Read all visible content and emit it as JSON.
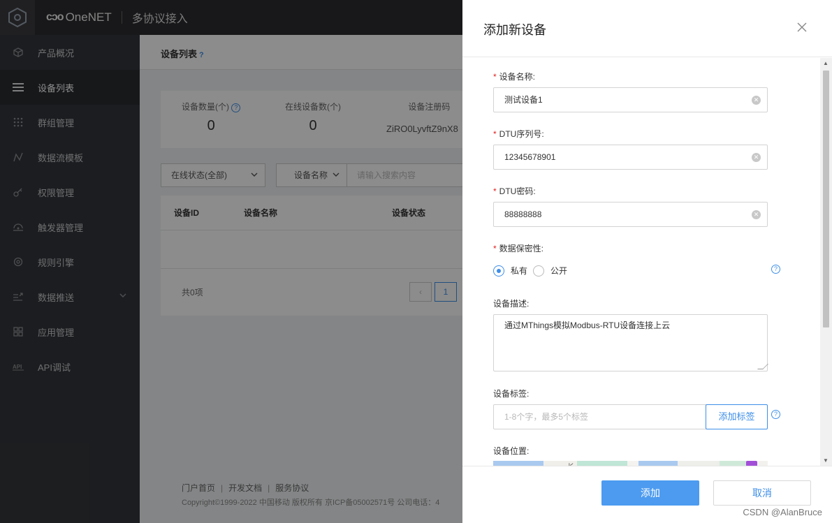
{
  "topbar": {
    "brand": "OneNET",
    "brand_logo_text": "cɔo",
    "subtitle": "多协议接入"
  },
  "sidebar": {
    "items": [
      {
        "label": "产品概况",
        "icon": "cube-icon"
      },
      {
        "label": "设备列表",
        "icon": "list-icon",
        "active": true
      },
      {
        "label": "群组管理",
        "icon": "grid-dots-icon"
      },
      {
        "label": "数据流模板",
        "icon": "stream-icon"
      },
      {
        "label": "权限管理",
        "icon": "key-icon"
      },
      {
        "label": "触发器管理",
        "icon": "trigger-icon"
      },
      {
        "label": "规则引擎",
        "icon": "rule-icon"
      },
      {
        "label": "数据推送",
        "icon": "push-icon",
        "expandable": true
      },
      {
        "label": "应用管理",
        "icon": "apps-icon"
      },
      {
        "label": "API调试",
        "icon": "api-icon"
      }
    ]
  },
  "main": {
    "title": "设备列表",
    "stats": [
      {
        "label": "设备数量(个)",
        "value": "0",
        "help": true
      },
      {
        "label": "在线设备数(个)",
        "value": "0"
      },
      {
        "label": "设备注册码",
        "value": "ZiRO0LyvftZ9nX8"
      }
    ],
    "filter_status": "在线状态(全部)",
    "filter_field": "设备名称",
    "search_placeholder": "请输入搜索内容",
    "table_headers": [
      "设备ID",
      "设备名称",
      "设备状态"
    ],
    "total": "共0项",
    "page_current": "1",
    "footer_links": [
      "门户首页",
      "开发文档",
      "服务协议"
    ],
    "copyright": "Copyright©1999-2022 中国移动 版权所有 京ICP备05002571号 公司电话：4"
  },
  "drawer": {
    "title": "添加新设备",
    "fields": {
      "name": {
        "label": "设备名称:",
        "value": "测试设备1"
      },
      "dtu_serial": {
        "label": "DTU序列号:",
        "value": "12345678901"
      },
      "dtu_password": {
        "label": "DTU密码:",
        "value": "88888888"
      },
      "privacy": {
        "label": "数据保密性:",
        "options": [
          "私有",
          "公开"
        ],
        "selected": "私有"
      },
      "description": {
        "label": "设备描述:",
        "value": "通过MThings模拟Modbus-RTU设备连接上云"
      },
      "tags": {
        "label": "设备标签:",
        "placeholder": "1-8个字，最多5个标签",
        "button": "添加标签"
      },
      "location": {
        "label": "设备位置:"
      }
    },
    "map_label": "长",
    "submit": "添加",
    "cancel": "取消"
  },
  "watermark": "CSDN @AlanBruce",
  "colors": {
    "primary": "#3d8ee8",
    "primary_button": "#4c9bf0",
    "sidebar_bg": "#33363b",
    "topbar_bg": "#2d2d30",
    "required": "#e02020"
  }
}
